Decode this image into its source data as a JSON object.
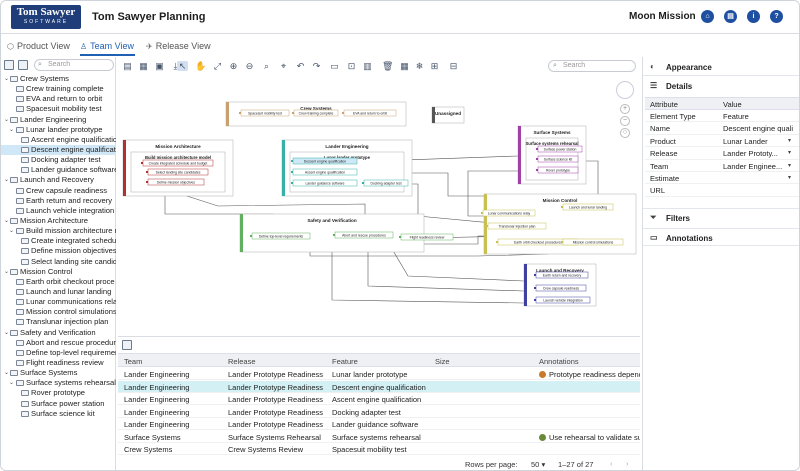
{
  "header": {
    "logo_line1": "Tom Sawyer",
    "logo_line2": "SOFTWARE",
    "app_title": "Tom Sawyer Planning",
    "project": "Moon Mission",
    "buttons": [
      {
        "glyph": "⌂",
        "name": "home-button"
      },
      {
        "glyph": "▤",
        "name": "document-button"
      },
      {
        "glyph": "i",
        "name": "info-button"
      },
      {
        "glyph": "?",
        "name": "help-button"
      }
    ]
  },
  "tabs": [
    {
      "label": "Product View",
      "icon": "cube-icon"
    },
    {
      "label": "Team View",
      "icon": "person-icon"
    },
    {
      "label": "Release View",
      "icon": "rocket-icon"
    }
  ],
  "left": {
    "search_placeholder": "Search",
    "tree": [
      {
        "label": "Crew Systems",
        "level": 0,
        "twisty": "v"
      },
      {
        "label": "Crew training complete",
        "level": 1
      },
      {
        "label": "EVA and return to orbit",
        "level": 1
      },
      {
        "label": "Spacesuit mobility test",
        "level": 1
      },
      {
        "label": "Lander Engineering",
        "level": 0,
        "twisty": "v"
      },
      {
        "label": "Lunar lander prototype",
        "level": 1,
        "twisty": "v"
      },
      {
        "label": "Ascent engine qualificatio",
        "level": 2
      },
      {
        "label": "Descent engine qualificati",
        "level": 2,
        "selected": true
      },
      {
        "label": "Docking adapter test",
        "level": 2
      },
      {
        "label": "Lander guidance software",
        "level": 2
      },
      {
        "label": "Launch and Recovery",
        "level": 0,
        "twisty": "v"
      },
      {
        "label": "Crew capsule readiness",
        "level": 1
      },
      {
        "label": "Earth return and recovery",
        "level": 1
      },
      {
        "label": "Launch vehicle integration",
        "level": 1
      },
      {
        "label": "Mission Architecture",
        "level": 0,
        "twisty": "v"
      },
      {
        "label": "Build mission architecture r",
        "level": 1,
        "twisty": "v"
      },
      {
        "label": "Create integrated schedul",
        "level": 2
      },
      {
        "label": "Define mission objectives",
        "level": 2
      },
      {
        "label": "Select landing site candida",
        "level": 2
      },
      {
        "label": "Mission Control",
        "level": 0,
        "twisty": "v"
      },
      {
        "label": "Earth orbit checkout proce",
        "level": 1
      },
      {
        "label": "Launch and lunar landing",
        "level": 1
      },
      {
        "label": "Lunar communications relay",
        "level": 1
      },
      {
        "label": "Mission control simulations",
        "level": 1
      },
      {
        "label": "Translunar injection plan",
        "level": 1
      },
      {
        "label": "Safety and Verification",
        "level": 0,
        "twisty": "v"
      },
      {
        "label": "Abort and rescue procedure",
        "level": 1
      },
      {
        "label": "Define top-level requiremen",
        "level": 1
      },
      {
        "label": "Flight readiness review",
        "level": 1
      },
      {
        "label": "Surface Systems",
        "level": 0,
        "twisty": "v"
      },
      {
        "label": "Surface systems rehearsal",
        "level": 1,
        "twisty": "v"
      },
      {
        "label": "Rover prototype",
        "level": 2
      },
      {
        "label": "Surface power station",
        "level": 2
      },
      {
        "label": "Surface science kit",
        "level": 2
      }
    ]
  },
  "diagram": {
    "search_placeholder": "Search",
    "groups": [
      {
        "title": "Crew Systems",
        "color": "#c9a070",
        "items": [
          "Spacesuit mobility test",
          "Crew training complete",
          "EVA and return to orbit"
        ]
      },
      {
        "title": "Unassigned",
        "color": "#555555",
        "items": []
      },
      {
        "title": "Mission Architecture",
        "color": "#b03030",
        "sub": "Build mission architecture model",
        "items": [
          "Create integrated schedule and budget",
          "Select landing site candidates",
          "Define mission objectives"
        ]
      },
      {
        "title": "Lander Engineering",
        "color": "#38b0a8",
        "sub": "Lunar lander prototype",
        "items": [
          "Descent engine qualification",
          "Ascent engine qualification",
          "Lander guidance software",
          "Docking adapter test"
        ]
      },
      {
        "title": "Surface Systems",
        "color": "#a040a8",
        "sub": "Surface systems rehearsal",
        "items": [
          "Surface power station",
          "Surface science kit",
          "Rover prototype"
        ]
      },
      {
        "title": "Mission Control",
        "color": "#c8c050",
        "items": [
          "Launch and lunar landing",
          "Lunar communications relay",
          "Translunar injection plan",
          "Earth orbit checkout procedures",
          "Mission control simulations"
        ]
      },
      {
        "title": "Safety and Verification",
        "color": "#60b060",
        "items": [
          "Define top-level requirements",
          "Abort and rescue procedures",
          "Flight readiness review"
        ]
      },
      {
        "title": "Launch and Recovery",
        "color": "#4040a0",
        "items": [
          "Earth return and recovery",
          "Crew capsule readiness",
          "Launch vehicle integration"
        ]
      }
    ]
  },
  "table": {
    "columns": [
      "Team",
      "Release",
      "Feature",
      "Size",
      "Annotations"
    ],
    "rows": [
      {
        "team": "Lander Engineering",
        "release": "Lander Prototype Readiness",
        "feature": "Lunar lander prototype",
        "size": "",
        "annotation": "Prototype readiness depenc",
        "dot": "#c87a2a"
      },
      {
        "team": "Lander Engineering",
        "release": "Lander Prototype Readiness",
        "feature": "Descent engine qualification",
        "size": "",
        "annotation": "",
        "selected": true
      },
      {
        "team": "Lander Engineering",
        "release": "Lander Prototype Readiness",
        "feature": "Ascent engine qualification",
        "size": "",
        "annotation": ""
      },
      {
        "team": "Lander Engineering",
        "release": "Lander Prototype Readiness",
        "feature": "Docking adapter test",
        "size": "",
        "annotation": ""
      },
      {
        "team": "Lander Engineering",
        "release": "Lander Prototype Readiness",
        "feature": "Lander guidance software",
        "size": "",
        "annotation": ""
      },
      {
        "team": "Surface Systems",
        "release": "Surface Systems Rehearsal",
        "feature": "Surface systems rehearsal",
        "size": "",
        "annotation": "Use rehearsal to validate su",
        "dot": "#6a8a3a"
      },
      {
        "team": "Crew Systems",
        "release": "Crew Systems Review",
        "feature": "Spacesuit mobility test",
        "size": "",
        "annotation": ""
      }
    ],
    "rows_per_page_label": "Rows per page:",
    "rows_per_page": "50",
    "range": "1–27 of 27"
  },
  "right": {
    "appearance": "Appearance",
    "details": "Details",
    "headers": [
      "Attribute",
      "Value"
    ],
    "props": [
      {
        "k": "Element Type",
        "v": "Feature"
      },
      {
        "k": "Name",
        "v": "Descent engine qualificati"
      },
      {
        "k": "Product",
        "v": "Lunar Lander",
        "dd": true
      },
      {
        "k": "Release",
        "v": "Lander Prototy...",
        "dd": true
      },
      {
        "k": "Team",
        "v": "Lander Enginee...",
        "dd": true
      },
      {
        "k": "Estimate",
        "v": "",
        "dd": true
      },
      {
        "k": "URL",
        "v": ""
      }
    ],
    "filters": "Filters",
    "annotations": "Annotations"
  }
}
